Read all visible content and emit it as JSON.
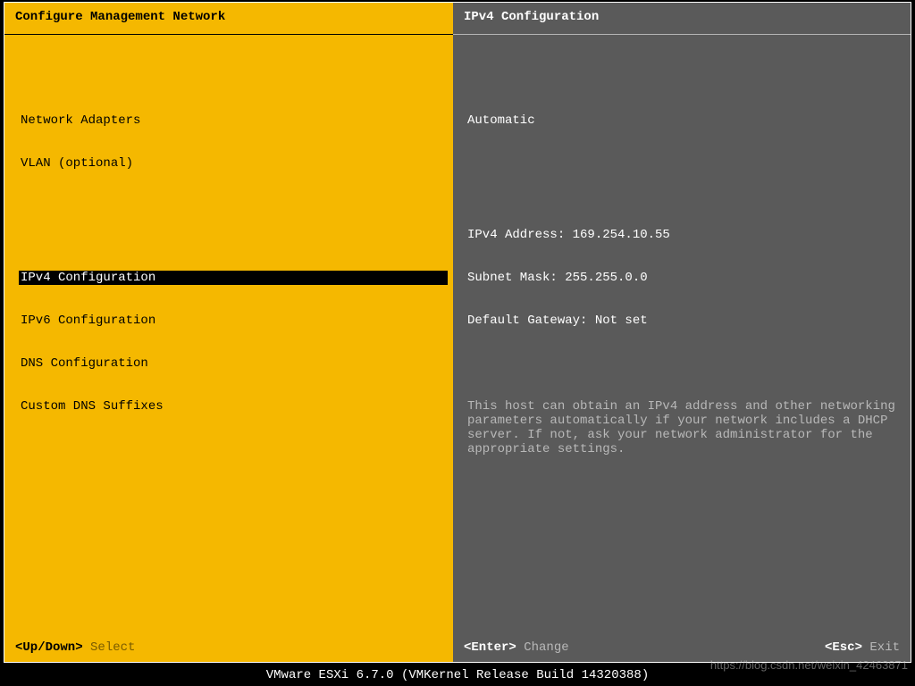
{
  "left": {
    "title": "Configure Management Network",
    "menu_group1": [
      "Network Adapters",
      "VLAN (optional)"
    ],
    "menu_group2": [
      "IPv4 Configuration",
      "IPv6 Configuration",
      "DNS Configuration",
      "Custom DNS Suffixes"
    ],
    "selected_index": 0,
    "footer_key": "<Up/Down>",
    "footer_action": "Select"
  },
  "right": {
    "title": "IPv4 Configuration",
    "mode": "Automatic",
    "lines": [
      "IPv4 Address: 169.254.10.55",
      "Subnet Mask: 255.255.0.0",
      "Default Gateway: Not set"
    ],
    "help": "This host can obtain an IPv4 address and other networking parameters automatically if your network includes a DHCP server. If not, ask your network administrator for the appropriate settings.",
    "footer_left_key": "<Enter>",
    "footer_left_action": "Change",
    "footer_right_key": "<Esc>",
    "footer_right_action": "Exit"
  },
  "bottom_bar": "VMware ESXi 6.7.0 (VMKernel Release Build 14320388)",
  "watermark": "https://blog.csdn.net/weixin_42463871"
}
